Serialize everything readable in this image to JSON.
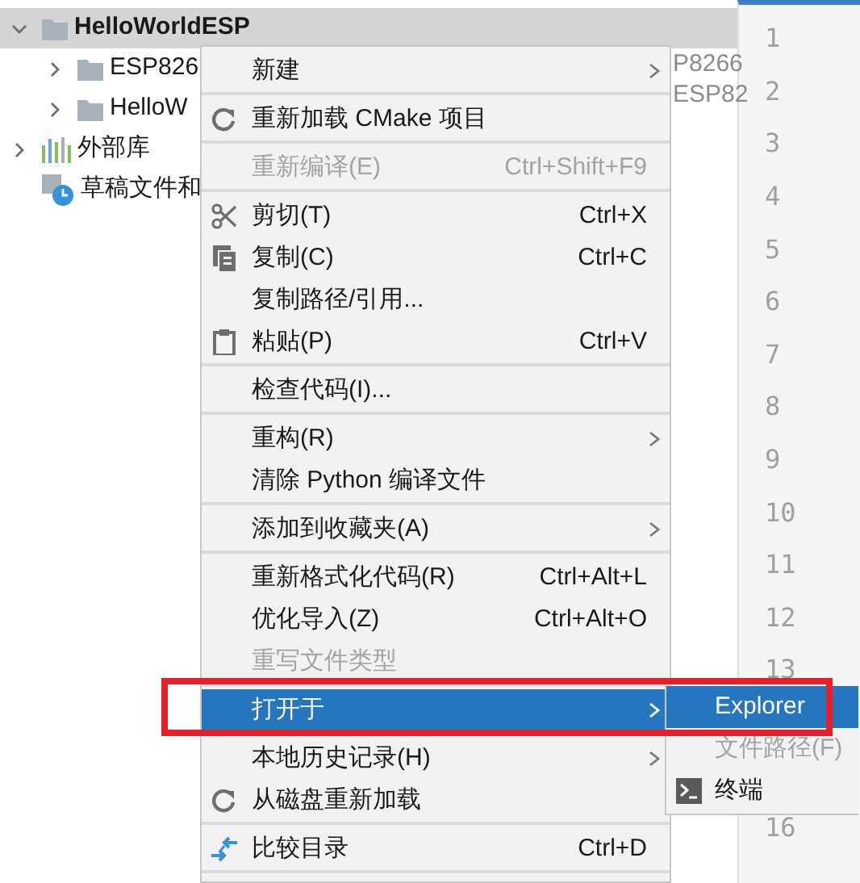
{
  "tree": [
    {
      "label": "HelloWorldESP",
      "kind": "folder",
      "expanded": true,
      "selected": true,
      "children": [
        {
          "label": "ESP826",
          "kind": "folder",
          "expanded": false,
          "selected": false,
          "trail": "P8266"
        },
        {
          "label": "HelloW",
          "kind": "folder",
          "expanded": false,
          "selected": false,
          "trail": "ESP82"
        }
      ]
    },
    {
      "label": "外部库",
      "kind": "library",
      "expanded": false,
      "selected": false
    },
    {
      "label": "草稿文件和",
      "kind": "scratch",
      "selected": false
    }
  ],
  "gutter": {
    "line_numbers": [
      "1",
      "2",
      "3",
      "4",
      "5",
      "6",
      "7",
      "8",
      "9",
      "10",
      "11",
      "12",
      "13"
    ],
    "line_numbers_below_submenu": [
      "16"
    ]
  },
  "context_menu": [
    {
      "kind": "plain",
      "label": "新建",
      "submenu": true,
      "disabled": false,
      "selected": false
    },
    {
      "kind": "separator"
    },
    {
      "kind": "reload",
      "label": "重新加载 CMake 项目",
      "disabled": false,
      "selected": false
    },
    {
      "kind": "separator"
    },
    {
      "kind": "plain",
      "label": "重新编译(E)",
      "shortcut": "Ctrl+Shift+F9",
      "disabled": true,
      "selected": false
    },
    {
      "kind": "separator"
    },
    {
      "kind": "cut",
      "label": "剪切(T)",
      "shortcut": "Ctrl+X",
      "disabled": false,
      "selected": false
    },
    {
      "kind": "copy",
      "label": "复制(C)",
      "shortcut": "Ctrl+C",
      "disabled": false,
      "selected": false
    },
    {
      "kind": "plain",
      "label": "复制路径/引用...",
      "disabled": false,
      "selected": false
    },
    {
      "kind": "paste",
      "label": "粘贴(P)",
      "shortcut": "Ctrl+V",
      "disabled": false,
      "selected": false
    },
    {
      "kind": "separator"
    },
    {
      "kind": "plain",
      "label": "检查代码(I)...",
      "disabled": false,
      "selected": false
    },
    {
      "kind": "separator"
    },
    {
      "kind": "plain",
      "label": "重构(R)",
      "submenu": true,
      "disabled": false,
      "selected": false
    },
    {
      "kind": "plain",
      "label": "清除 Python 编译文件",
      "disabled": false,
      "selected": false
    },
    {
      "kind": "separator"
    },
    {
      "kind": "plain",
      "label": "添加到收藏夹(A)",
      "submenu": true,
      "disabled": false,
      "selected": false
    },
    {
      "kind": "separator"
    },
    {
      "kind": "plain",
      "label": "重新格式化代码(R)",
      "shortcut": "Ctrl+Alt+L",
      "disabled": false,
      "selected": false
    },
    {
      "kind": "plain",
      "label": "优化导入(Z)",
      "shortcut": "Ctrl+Alt+O",
      "disabled": false,
      "selected": false
    },
    {
      "kind": "plain",
      "label": "重写文件类型",
      "disabled": true,
      "selected": false
    },
    {
      "kind": "separator"
    },
    {
      "kind": "plain",
      "label": "打开于",
      "submenu": true,
      "disabled": false,
      "selected": true
    },
    {
      "kind": "separator"
    },
    {
      "kind": "plain",
      "label": "本地历史记录(H)",
      "submenu": true,
      "disabled": false,
      "selected": false
    },
    {
      "kind": "reload",
      "label": "从磁盘重新加载",
      "disabled": false,
      "selected": false
    },
    {
      "kind": "separator"
    },
    {
      "kind": "compare",
      "label": "比较目录",
      "shortcut": "Ctrl+D",
      "disabled": false,
      "selected": false
    },
    {
      "kind": "separator"
    }
  ],
  "submenu": [
    {
      "kind": "plain",
      "label": "Explorer",
      "disabled": false,
      "selected": true
    },
    {
      "kind": "plain",
      "label": "文件路径(F)",
      "disabled": true,
      "selected": false
    },
    {
      "kind": "terminal",
      "label": "终端",
      "disabled": false,
      "selected": false
    }
  ],
  "annotation": {
    "kind": "rectangle",
    "color": "#e8202a"
  }
}
